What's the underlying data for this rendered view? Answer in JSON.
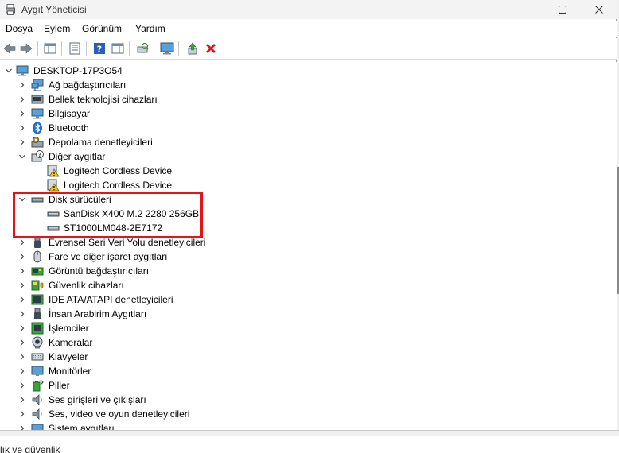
{
  "window": {
    "title": "Aygıt Yöneticisi"
  },
  "menu": [
    "Dosya",
    "Eylem",
    "Görünüm",
    "Yardım"
  ],
  "tree": {
    "root": "DESKTOP-17P3O54",
    "categories": [
      {
        "label": "Ağ bağdaştırıcıları",
        "icon": "network-adapter-icon"
      },
      {
        "label": "Bellek teknolojisi cihazları",
        "icon": "memory-tech-icon"
      },
      {
        "label": "Bilgisayar",
        "icon": "computer-icon"
      },
      {
        "label": "Bluetooth",
        "icon": "bluetooth-icon"
      },
      {
        "label": "Depolama denetleyicileri",
        "icon": "storage-controller-icon"
      },
      {
        "label": "Diğer aygıtlar",
        "icon": "unknown-device-icon",
        "children": [
          "Logitech Cordless Device",
          "Logitech Cordless Device"
        ]
      },
      {
        "label": "Disk sürücüleri",
        "icon": "disk-drive-icon",
        "children": [
          "SanDisk X400 M.2 2280 256GB",
          "ST1000LM048-2E7172"
        ]
      },
      {
        "label": "Evrensel Seri Veri Yolu denetleyicileri",
        "icon": "usb-controller-icon"
      },
      {
        "label": "Fare ve diğer işaret aygıtları",
        "icon": "mouse-icon"
      },
      {
        "label": "Görüntü bağdaştırıcıları",
        "icon": "display-adapter-icon"
      },
      {
        "label": "Güvenlik cihazları",
        "icon": "security-device-icon"
      },
      {
        "label": "IDE ATA/ATAPI denetleyicileri",
        "icon": "ide-controller-icon"
      },
      {
        "label": "İnsan Arabirim Aygıtları",
        "icon": "hid-icon"
      },
      {
        "label": "İşlemciler",
        "icon": "processor-icon"
      },
      {
        "label": "Kameralar",
        "icon": "camera-icon"
      },
      {
        "label": "Klavyeler",
        "icon": "keyboard-icon"
      },
      {
        "label": "Monitörler",
        "icon": "monitor-icon"
      },
      {
        "label": "Piller",
        "icon": "battery-icon"
      },
      {
        "label": "Ses girişleri ve çıkışları",
        "icon": "audio-io-icon"
      },
      {
        "label": "Ses, video ve oyun denetleyicileri",
        "icon": "sound-video-icon"
      },
      {
        "label": "Sistem aygıtları",
        "icon": "system-devices-icon"
      }
    ]
  },
  "below_window_text": "lık ve güvenlik",
  "colors": {
    "highlight": "#e41515",
    "warning": "#f5c518",
    "remove": "#d31c1c",
    "accent": "#2b5fb4"
  }
}
